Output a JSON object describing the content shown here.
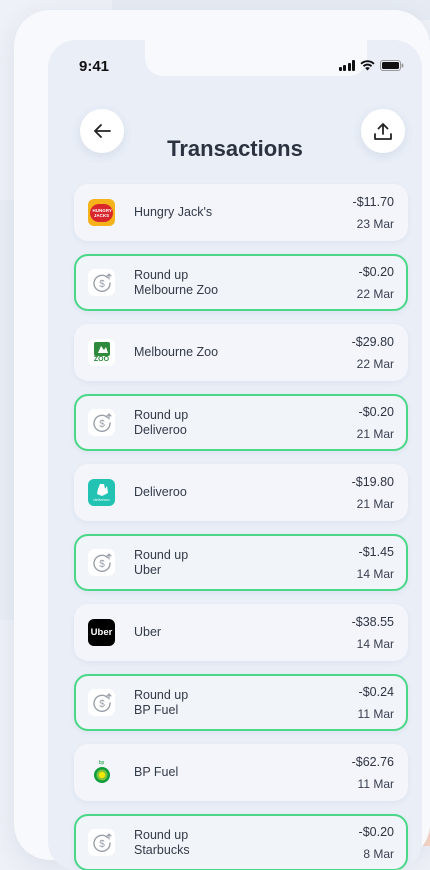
{
  "status_bar": {
    "time": "9:41"
  },
  "header": {
    "title": "Transactions"
  },
  "transactions": [
    {
      "name": "Hungry Jack's",
      "amount": "-$11.70",
      "date": "23 Mar",
      "roundup": false,
      "logo": "hungry-jacks-logo",
      "logo_text": "HUNGRY JACKS"
    },
    {
      "name": "Round up",
      "subtitle": "Melbourne Zoo",
      "amount": "-$0.20",
      "date": "22 Mar",
      "roundup": true
    },
    {
      "name": "Melbourne Zoo",
      "amount": "-$29.80",
      "date": "22 Mar",
      "roundup": false,
      "logo": "melbourne-zoo-logo",
      "logo_text": "ZOO"
    },
    {
      "name": "Round up",
      "subtitle": "Deliveroo",
      "amount": "-$0.20",
      "date": "21 Mar",
      "roundup": true
    },
    {
      "name": "Deliveroo",
      "amount": "-$19.80",
      "date": "21 Mar",
      "roundup": false,
      "logo": "deliveroo-logo",
      "logo_text": "deliveroo"
    },
    {
      "name": "Round up",
      "subtitle": "Uber",
      "amount": "-$1.45",
      "date": "14 Mar",
      "roundup": true
    },
    {
      "name": "Uber",
      "amount": "-$38.55",
      "date": "14 Mar",
      "roundup": false,
      "logo": "uber-logo",
      "logo_text": "Uber"
    },
    {
      "name": "Round up",
      "subtitle": "BP Fuel",
      "amount": "-$0.24",
      "date": "11 Mar",
      "roundup": true
    },
    {
      "name": "BP Fuel",
      "amount": "-$62.76",
      "date": "11 Mar",
      "roundup": false,
      "logo": "bp-logo",
      "logo_text": "bp"
    },
    {
      "name": "Round up",
      "subtitle": "Starbucks",
      "amount": "-$0.20",
      "date": "8 Mar",
      "roundup": true
    }
  ],
  "colors": {
    "roundup_border": "#4ad788",
    "hungry_jacks_red": "#d9262c",
    "hungry_jacks_yellow": "#f5b21b",
    "zoo_green": "#2f8a3e",
    "deliveroo_teal": "#22c3b3",
    "uber_black": "#000000",
    "bp_green": "#0f9d3a",
    "bp_yellow": "#f3e600"
  },
  "icons": {
    "back": "arrow-left-icon",
    "share": "upload-icon",
    "roundup": "coin-up-icon"
  }
}
